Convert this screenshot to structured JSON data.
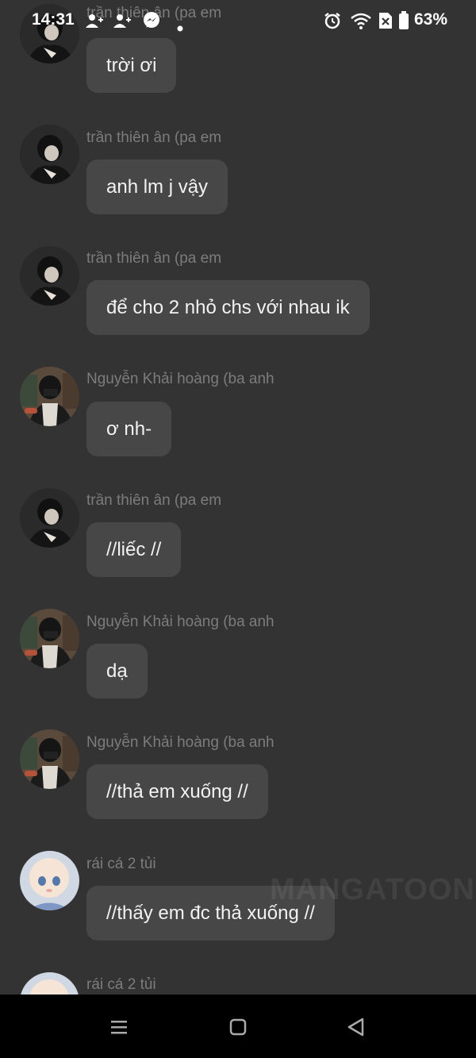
{
  "status_bar": {
    "time": "14:31",
    "battery": "63%",
    "icons": [
      "contact-add-icon",
      "contact-add-icon",
      "messenger-icon",
      "notification-dot-icon",
      "alarm-icon",
      "wifi-icon",
      "no-sim-icon",
      "battery-icon"
    ]
  },
  "messages": [
    {
      "sender": "trần thiên ân (pa em",
      "text": "trời ơi",
      "avatar": "avatar-boy-dark"
    },
    {
      "sender": "trần thiên ân (pa em",
      "text": "anh lm j vậy",
      "avatar": "avatar-boy-dark"
    },
    {
      "sender": "trần thiên ân (pa em",
      "text": "để cho 2 nhỏ chs với nhau ik",
      "avatar": "avatar-boy-dark"
    },
    {
      "sender": "Nguyễn Khải hoàng (ba anh",
      "text": "ơ nh-",
      "avatar": "avatar-boy-room"
    },
    {
      "sender": "trần thiên ân (pa em",
      "text": "//liếc //",
      "avatar": "avatar-boy-dark"
    },
    {
      "sender": "Nguyễn Khải hoàng (ba anh",
      "text": "dạ",
      "avatar": "avatar-boy-room"
    },
    {
      "sender": "Nguyễn Khải hoàng (ba anh",
      "text": "//thả em xuống //",
      "avatar": "avatar-boy-room"
    },
    {
      "sender": "rái cá 2 tủi",
      "text": "//thấy em đc thả xuống //",
      "avatar": "avatar-baby"
    },
    {
      "sender": "rái cá 2 tủi",
      "text": "",
      "avatar": "avatar-baby"
    }
  ],
  "watermark": "MANGATOON",
  "nav": {
    "icons": [
      "recents-icon",
      "home-icon",
      "back-icon"
    ]
  },
  "colors": {
    "background": "#333333",
    "bubble": "#474747",
    "sender_text": "#7c7c7c",
    "message_text": "#f2f2f2",
    "nav_bar": "#000000"
  }
}
